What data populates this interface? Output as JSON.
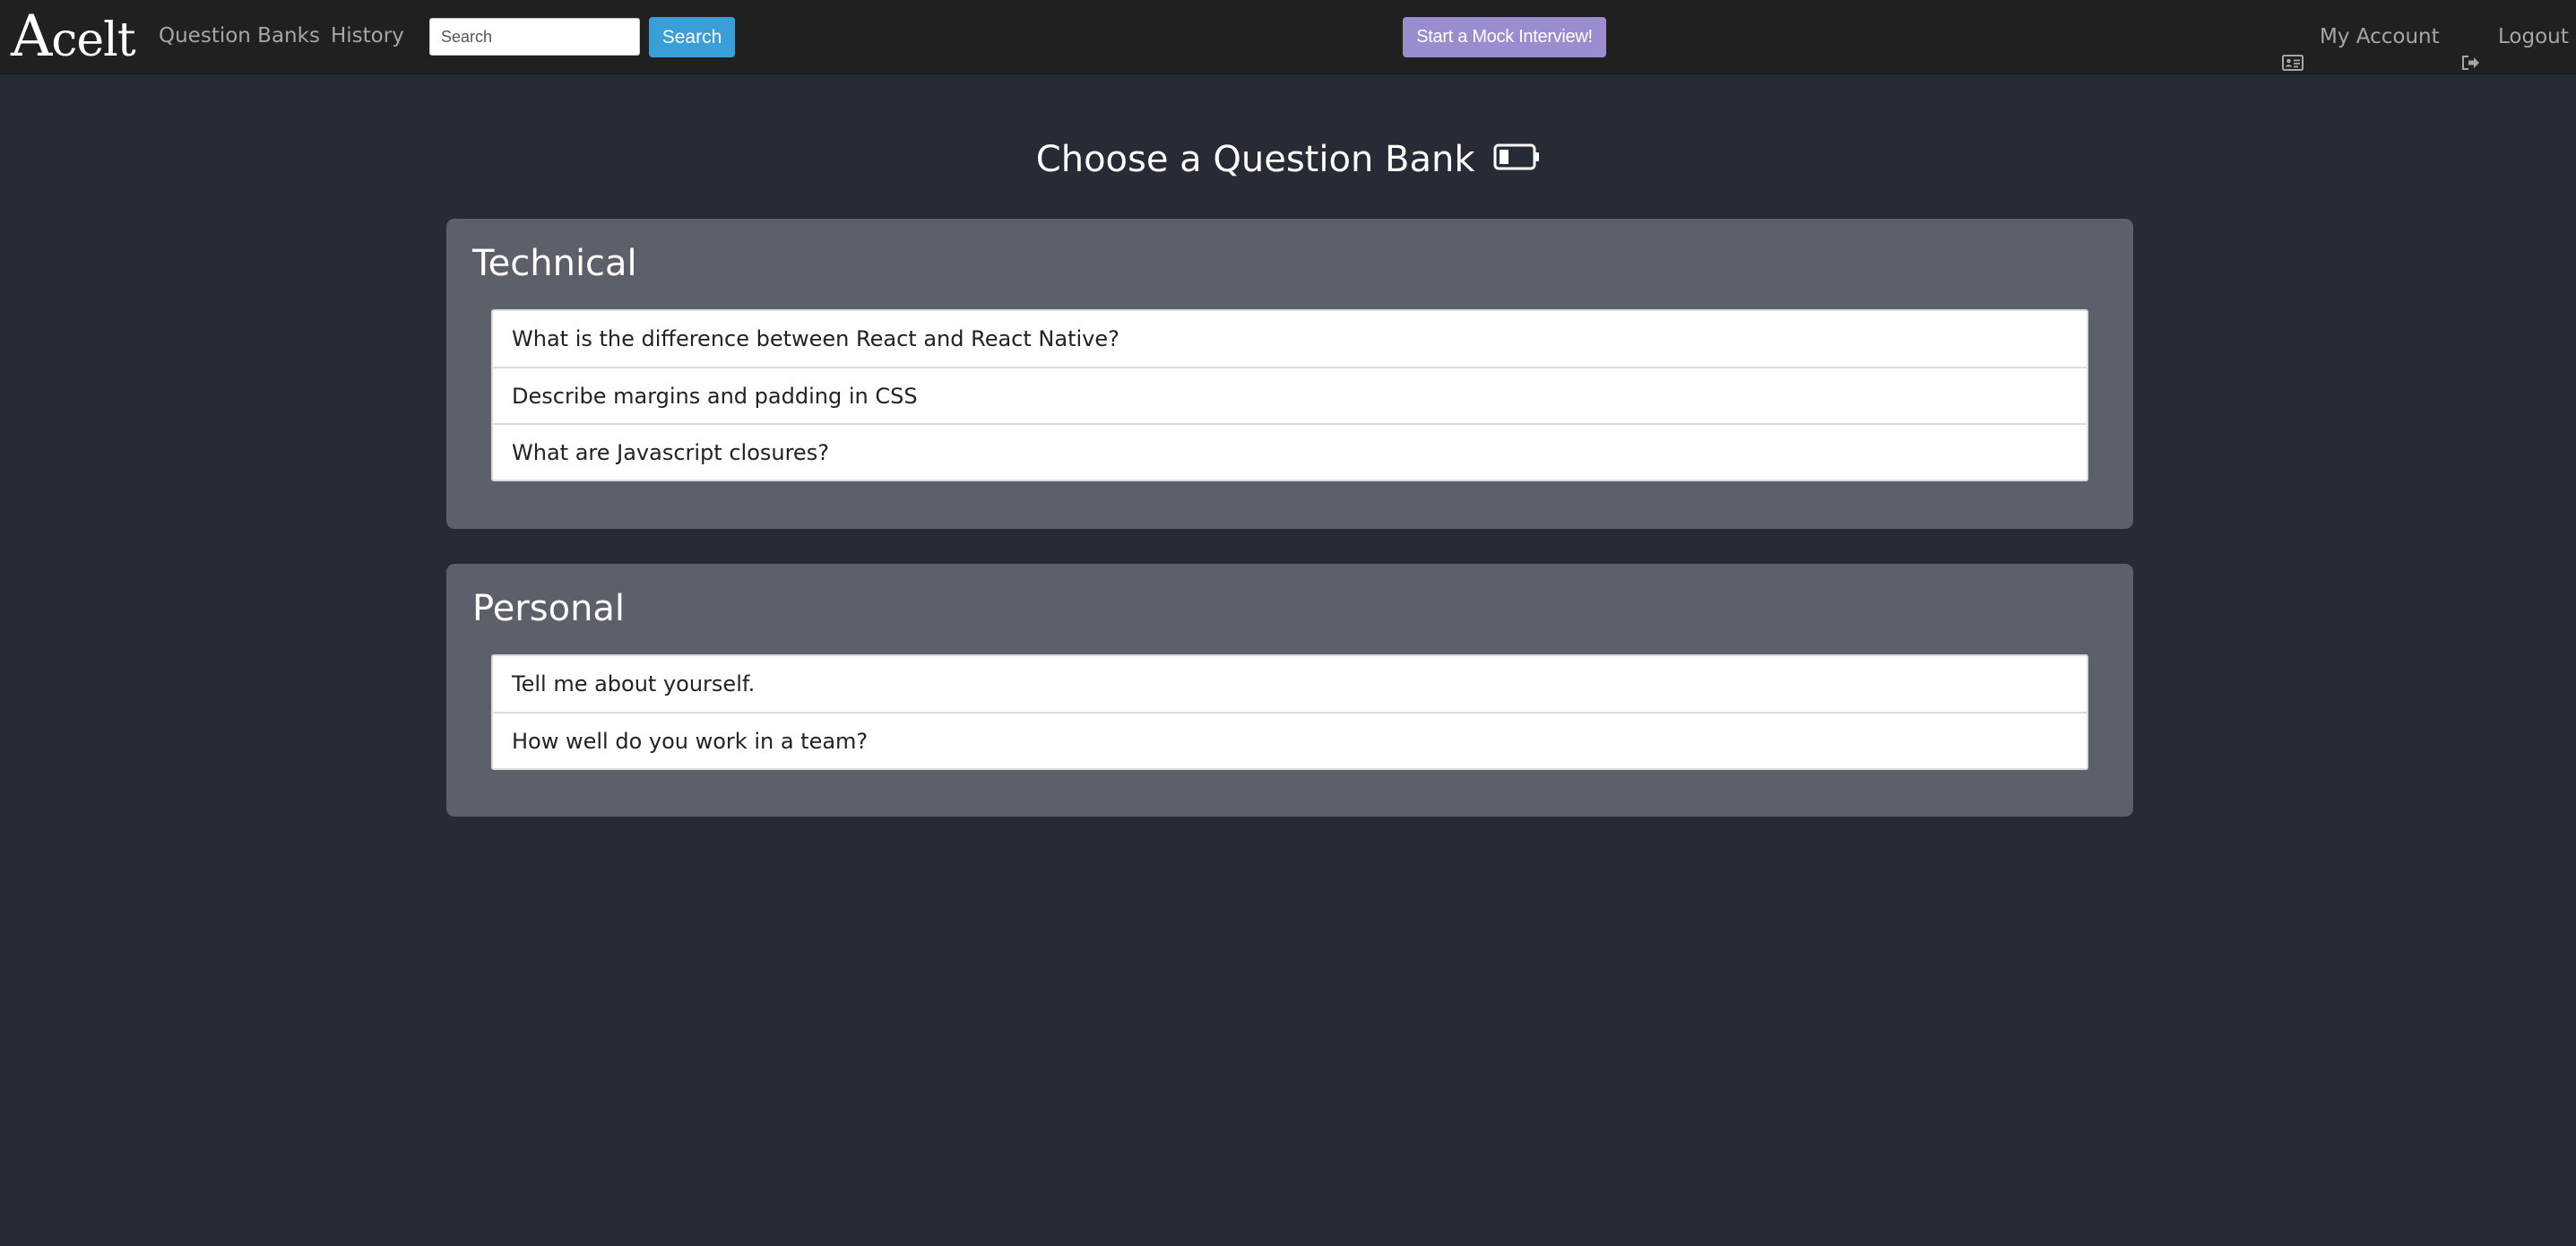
{
  "nav": {
    "brand_initial": "A",
    "brand_rest": "celt",
    "links": [
      {
        "label": "Question Banks"
      },
      {
        "label": "History"
      }
    ],
    "search": {
      "placeholder": "Search",
      "value": "",
      "button_label": "Search"
    },
    "mock_interview_label": "Start a Mock Interview!",
    "account_label": "My Account",
    "logout_label": "Logout"
  },
  "main": {
    "title": "Choose a Question Bank",
    "banks": [
      {
        "name": "Technical",
        "questions": [
          "What is the difference between React and React Native?",
          "Describe margins and padding in CSS",
          "What are Javascript closures?"
        ]
      },
      {
        "name": "Personal",
        "questions": [
          "Tell me about yourself.",
          "How well do you work in a team?"
        ]
      }
    ]
  },
  "colors": {
    "page_background": "#272b35",
    "navbar_background": "#202020",
    "panel_background": "#5c606b",
    "search_button": "#3a9fd6",
    "mock_button": "#9a8cce",
    "nav_text": "#a6a6a6"
  },
  "icons": {
    "account": "id-card-icon",
    "logout": "sign-out-icon",
    "title_decoration": "battery-icon"
  }
}
